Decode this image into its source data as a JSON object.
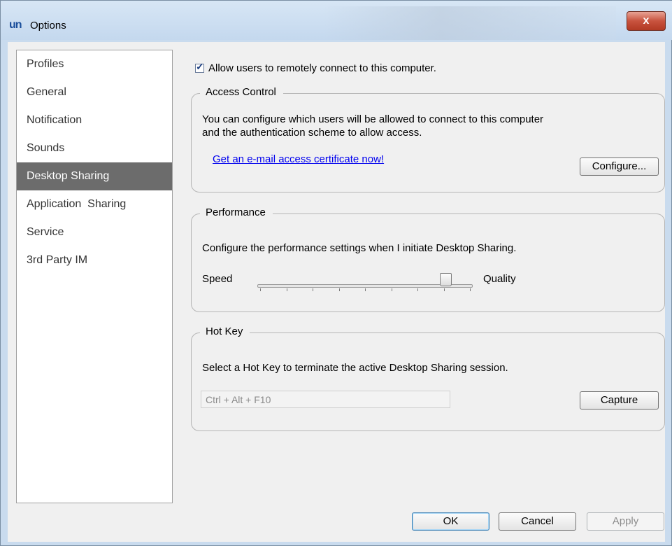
{
  "window": {
    "title": "Options",
    "logo": "un",
    "close_glyph": "x"
  },
  "sidebar": {
    "items": [
      {
        "label": "Profiles"
      },
      {
        "label": "General"
      },
      {
        "label": "Notification"
      },
      {
        "label": "Sounds"
      },
      {
        "label": "Desktop Sharing",
        "selected": true
      },
      {
        "label": "Application  Sharing"
      },
      {
        "label": "Service"
      },
      {
        "label": "3rd Party IM"
      }
    ]
  },
  "allow_remote": {
    "label": "Allow users to remotely connect to this computer.",
    "checked": true
  },
  "access_control": {
    "legend": "Access Control",
    "description_line1": "You can configure which users will be allowed to connect to this computer",
    "description_line2": "and the authentication scheme to allow access.",
    "link": "Get an e-mail access certificate now!",
    "configure_button": "Configure..."
  },
  "performance": {
    "legend": "Performance",
    "description": "Configure the performance settings when I initiate Desktop Sharing.",
    "left_label": "Speed",
    "right_label": "Quality",
    "slider_value": 0.875
  },
  "hotkey": {
    "legend": "Hot Key",
    "description": "Select a Hot Key to terminate the active Desktop Sharing session.",
    "value": "Ctrl + Alt + F10",
    "capture_button": "Capture"
  },
  "footer": {
    "ok": "OK",
    "cancel": "Cancel",
    "apply": "Apply"
  },
  "colors": {
    "selected_nav": "#6c6c6c",
    "link": "#0000ee",
    "close_button": "#c8533e"
  }
}
